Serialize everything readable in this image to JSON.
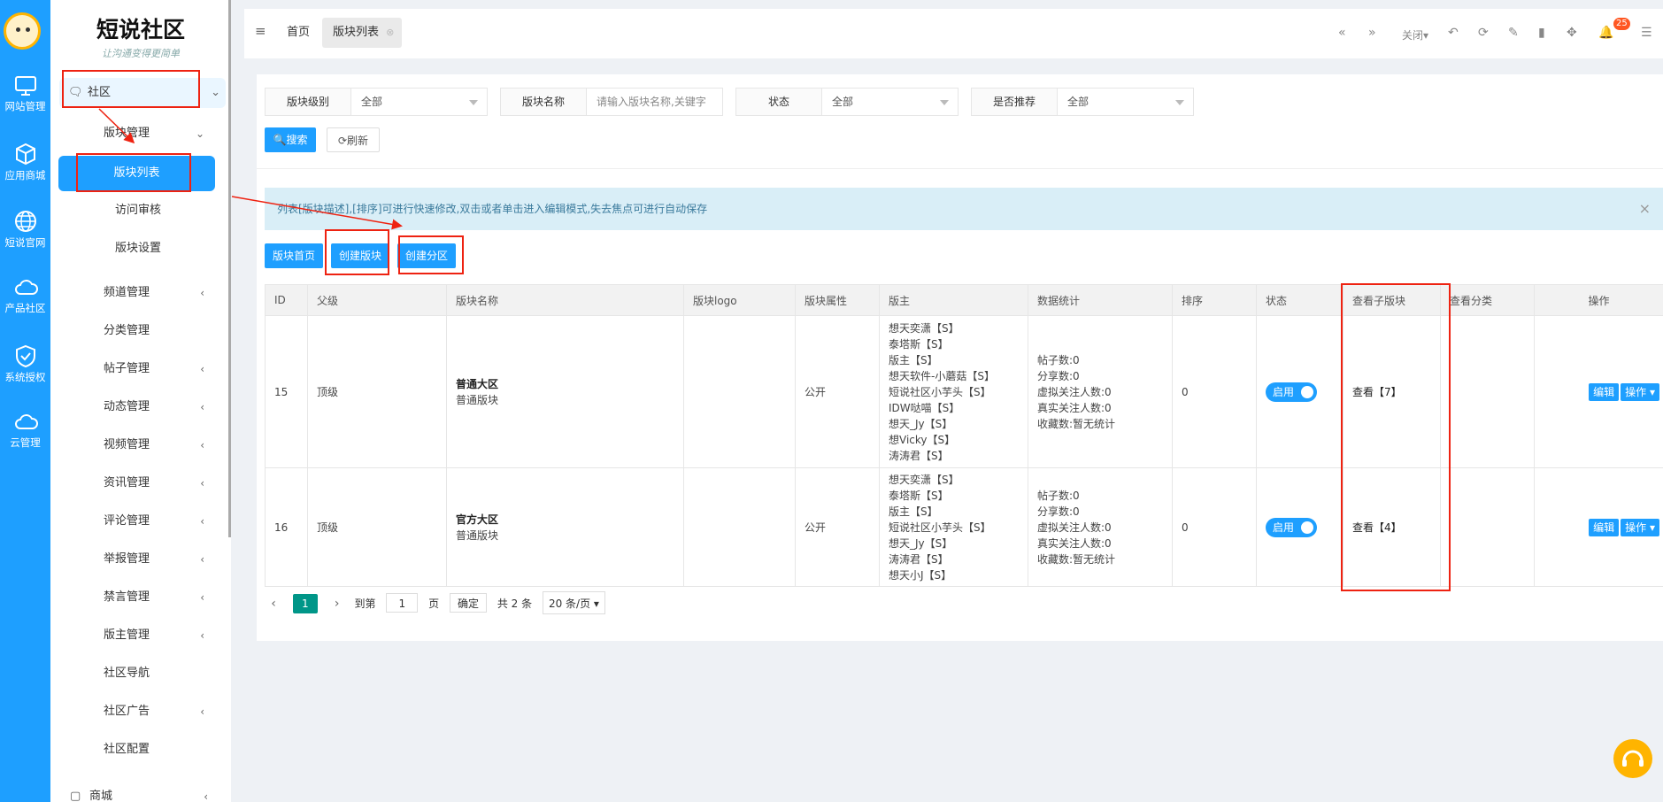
{
  "rail": {
    "items": [
      {
        "label": "网站管理",
        "icon": "monitor-icon"
      },
      {
        "label": "应用商城",
        "icon": "cube-icon"
      },
      {
        "label": "短说官网",
        "icon": "globe-icon"
      },
      {
        "label": "产品社区",
        "icon": "cloud-icon"
      },
      {
        "label": "系统授权",
        "icon": "shield-check-icon"
      },
      {
        "label": "云管理",
        "icon": "cloud-icon"
      }
    ]
  },
  "sidebar": {
    "brand": "短说社区",
    "slogan": "让沟通变得更简单",
    "community": "社区",
    "section": "版块管理",
    "sub": [
      "版块列表",
      "访问审核",
      "版块设置"
    ],
    "menus": [
      {
        "label": "频道管理",
        "chev": "‹"
      },
      {
        "label": "分类管理",
        "chev": ""
      },
      {
        "label": "帖子管理",
        "chev": "‹"
      },
      {
        "label": "动态管理",
        "chev": "‹"
      },
      {
        "label": "视频管理",
        "chev": "‹"
      },
      {
        "label": "资讯管理",
        "chev": "‹"
      },
      {
        "label": "评论管理",
        "chev": "‹"
      },
      {
        "label": "举报管理",
        "chev": "‹"
      },
      {
        "label": "禁言管理",
        "chev": "‹"
      },
      {
        "label": "版主管理",
        "chev": "‹"
      },
      {
        "label": "社区导航",
        "chev": ""
      },
      {
        "label": "社区广告",
        "chev": "‹"
      },
      {
        "label": "社区配置",
        "chev": ""
      }
    ],
    "next_group": "商城"
  },
  "header": {
    "home_tab": "首页",
    "current_tab": "版块列表",
    "close_label": "关闭",
    "badge": "25"
  },
  "filters": [
    {
      "key": "版块级别",
      "value": "全部",
      "select": true
    },
    {
      "key": "版块名称",
      "value": "请输入版块名称,关键字",
      "select": false
    },
    {
      "key": "状态",
      "value": "全部",
      "select": true
    },
    {
      "key": "是否推荐",
      "value": "全部",
      "select": true
    }
  ],
  "actions": {
    "search": "搜索",
    "refresh": "刷新",
    "home": "版块首页",
    "create_forum": "创建版块",
    "create_zone": "创建分区"
  },
  "notice": "列表[版块描述],[排序]可进行快速修改,双击或者单击进入编辑模式,失去焦点可进行自动保存",
  "notice_close": "×",
  "table": {
    "headers": [
      "ID",
      "父级",
      "版块名称",
      "版块logo",
      "版块属性",
      "版主",
      "数据统计",
      "排序",
      "状态",
      "查看子版块",
      "查看分类",
      "操作"
    ],
    "rows": [
      {
        "id": "15",
        "parent": "顶级",
        "name": "普通大区",
        "type": "普通版块",
        "attr": "公开",
        "moderators": [
          "想天奕潇【S】",
          "泰塔斯【S】",
          "版主【S】",
          "想天软件-小蘑菇【S】",
          "短说社区小芋头【S】",
          "IDW哒喵【S】",
          "想天_Jy【S】",
          "想Vicky【S】",
          "涛涛君【S】"
        ],
        "stats": [
          "帖子数:0",
          "分享数:0",
          "虚拟关注人数:0",
          "真实关注人数:0",
          "收藏数:暂无统计"
        ],
        "sort": "0",
        "status": "启用",
        "children": "查看【7】",
        "edit": "编辑",
        "ops": "操作 ▾"
      },
      {
        "id": "16",
        "parent": "顶级",
        "name": "官方大区",
        "type": "普通版块",
        "attr": "公开",
        "moderators": [
          "想天奕潇【S】",
          "泰塔斯【S】",
          "版主【S】",
          "短说社区小芋头【S】",
          "想天_Jy【S】",
          "涛涛君【S】",
          "想天小J【S】"
        ],
        "stats": [
          "帖子数:0",
          "分享数:0",
          "虚拟关注人数:0",
          "真实关注人数:0",
          "收藏数:暂无统计"
        ],
        "sort": "0",
        "status": "启用",
        "children": "查看【4】",
        "edit": "编辑",
        "ops": "操作 ▾"
      }
    ]
  },
  "pager": {
    "page": "1",
    "goto_label": "到第",
    "goto_value": "1",
    "page_unit": "页",
    "confirm": "确定",
    "total": "共 2 条",
    "per_page": "20 条/页"
  },
  "colors": {
    "primary": "#1e9fff",
    "annotation": "#ee2211"
  }
}
